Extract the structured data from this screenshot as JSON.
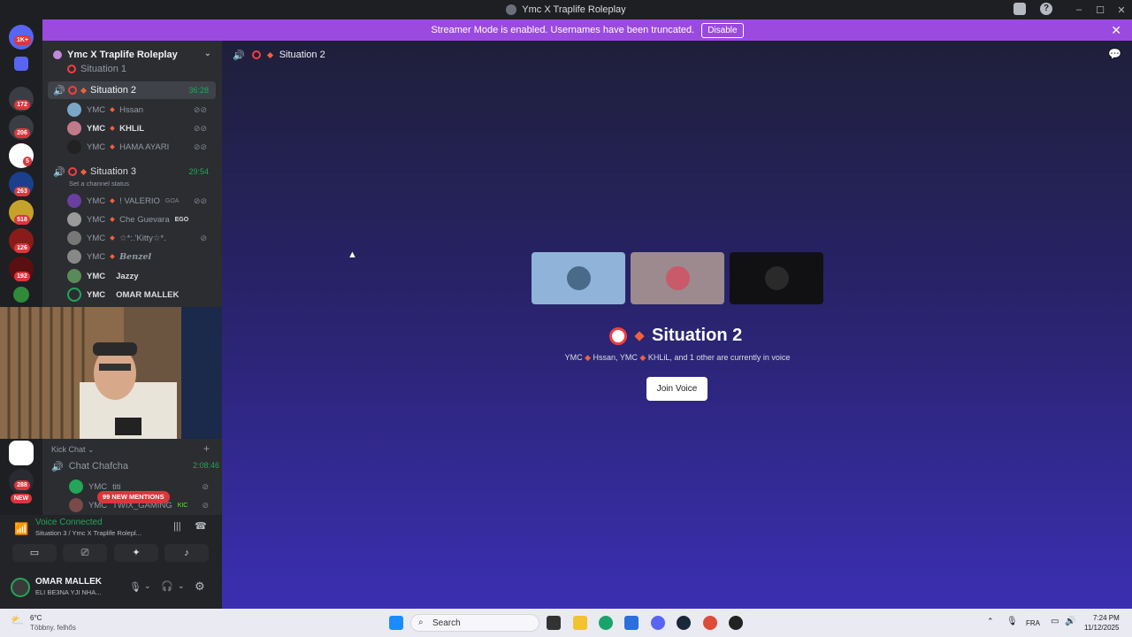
{
  "window": {
    "title": "Ymc X Traplife Roleplay"
  },
  "banner": {
    "text": "Streamer Mode is enabled. Usernames have been truncated.",
    "disable_label": "Disable"
  },
  "rail": {
    "badges": [
      "1K+",
      "172",
      "206",
      "5",
      "263",
      "518",
      "126",
      "192",
      "288",
      "NEW"
    ]
  },
  "server": {
    "name": "Ymc X Traplife Roleplay"
  },
  "channels": {
    "partial": "Situation 1",
    "situation2": {
      "name": "Situation 2",
      "timer": "36:28",
      "members": [
        {
          "tag": "YMC",
          "name": "Hssan"
        },
        {
          "tag": "YMC",
          "name": "KHLiL"
        },
        {
          "tag": "YMC",
          "name": "HAMA AYARI"
        }
      ]
    },
    "situation3": {
      "name": "Situation 3",
      "timer": "29:54",
      "status": "Set a channel status",
      "members": [
        {
          "tag": "YMC",
          "name": "! VALERIO",
          "badge": "GOA"
        },
        {
          "tag": "YMC",
          "name": "Che Guevara",
          "badge": "EGO"
        },
        {
          "tag": "YMC",
          "name": "☆*:.'Kitty☆*."
        },
        {
          "tag": "YMC",
          "name": "Benzel"
        },
        {
          "tag": "YMC",
          "name": "Jazzy"
        },
        {
          "tag": "YMC",
          "name": "OMAR MALLEK"
        }
      ]
    }
  },
  "kick": {
    "category": "Kick Chat",
    "channel": "Chat Chafcha",
    "timer": "2:08:46",
    "members": [
      {
        "tag": "YMC",
        "name": "titi"
      },
      {
        "tag": "YMC",
        "name": "TWIX_GAMING",
        "badge": "KIC"
      }
    ],
    "mentions": "99 NEW MENTIONS"
  },
  "voice": {
    "status": "Voice Connected",
    "location": "Situation 3 / Ymc X Traplife Rolepl..."
  },
  "user": {
    "name": "OMAR MALLEK",
    "status": "ELI BE3NA YJI NHA..."
  },
  "main": {
    "header": "Situation 2",
    "title": "Situation 2",
    "sub_parts": [
      "YMC",
      "Hssan, YMC",
      "KHLiL, and 1 other are currently in voice"
    ],
    "join": "Join Voice"
  },
  "taskbar": {
    "weather_temp": "6°C",
    "weather_desc": "Többny. felhős",
    "search": "Search",
    "lang": "FRA",
    "time": "7:24 PM",
    "date": "11/12/2025"
  },
  "colors": {
    "accent": "#9b4ae0",
    "voice_green": "#23a55a",
    "danger": "#f23f42"
  }
}
